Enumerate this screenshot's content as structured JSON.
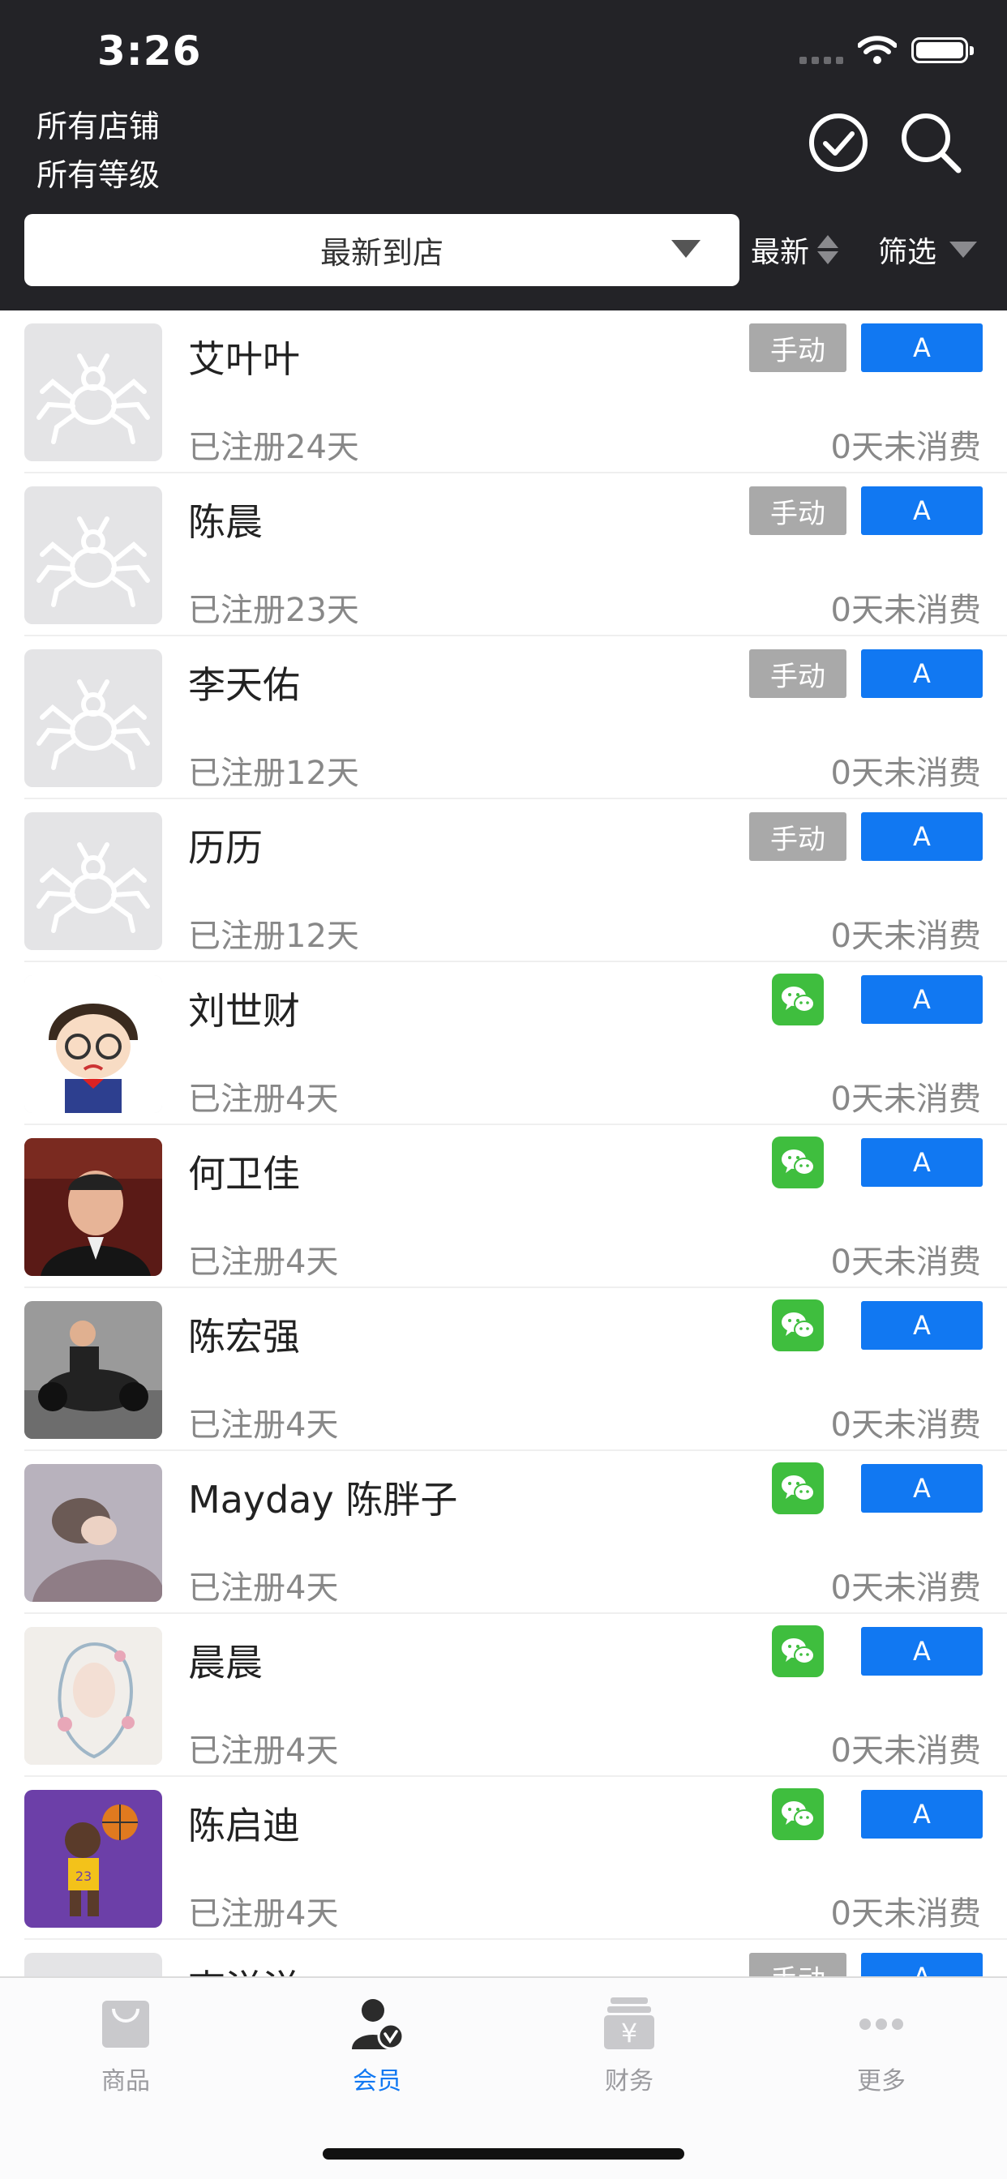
{
  "status_bar": {
    "time": "3:26"
  },
  "header": {
    "store_filter": "所有店铺",
    "level_filter": "所有等级",
    "sort_select": "最新到店",
    "sort_order": "最新",
    "filter_label": "筛选"
  },
  "members": [
    {
      "name": "艾叶叶",
      "source": "手动",
      "level": "A",
      "registered": "已注册24天",
      "no_spend": "0天未消费",
      "avatar": "spider-icon"
    },
    {
      "name": "陈晨",
      "source": "手动",
      "level": "A",
      "registered": "已注册23天",
      "no_spend": "0天未消费",
      "avatar": "spider-icon"
    },
    {
      "name": "李天佑",
      "source": "手动",
      "level": "A",
      "registered": "已注册12天",
      "no_spend": "0天未消费",
      "avatar": "spider-icon"
    },
    {
      "name": "历历",
      "source": "手动",
      "level": "A",
      "registered": "已注册12天",
      "no_spend": "0天未消费",
      "avatar": "spider-icon"
    },
    {
      "name": "刘世财",
      "source": "wechat",
      "level": "A",
      "registered": "已注册4天",
      "no_spend": "0天未消费",
      "avatar": "cartoon-boy"
    },
    {
      "name": "何卫佳",
      "source": "wechat",
      "level": "A",
      "registered": "已注册4天",
      "no_spend": "0天未消费",
      "avatar": "man-photo"
    },
    {
      "name": "陈宏强",
      "source": "wechat",
      "level": "A",
      "registered": "已注册4天",
      "no_spend": "0天未消费",
      "avatar": "kart-photo"
    },
    {
      "name": "Mayday 陈胖子",
      "source": "wechat",
      "level": "A",
      "registered": "已注册4天",
      "no_spend": "0天未消费",
      "avatar": "sleeping-child-photo"
    },
    {
      "name": "晨晨",
      "source": "wechat",
      "level": "A",
      "registered": "已注册4天",
      "no_spend": "0天未消费",
      "avatar": "floral-drawing"
    },
    {
      "name": "陈启迪",
      "source": "wechat",
      "level": "A",
      "registered": "已注册4天",
      "no_spend": "0天未消费",
      "avatar": "basketball-cartoon"
    },
    {
      "name": "李洋洋",
      "source": "手动",
      "level": "A",
      "registered": "",
      "no_spend": "",
      "avatar": "spider-icon"
    }
  ],
  "tabbar": {
    "tabs": [
      {
        "label": "商品",
        "icon": "bag-icon"
      },
      {
        "label": "会员",
        "icon": "member-icon"
      },
      {
        "label": "财务",
        "icon": "finance-icon"
      },
      {
        "label": "更多",
        "icon": "more-icon"
      }
    ],
    "active": "会员"
  },
  "colors": {
    "header_bg": "#232327",
    "accent_blue": "#1178f2",
    "wechat_green": "#3fbe3e",
    "manual_gray": "#a9a9a9"
  }
}
